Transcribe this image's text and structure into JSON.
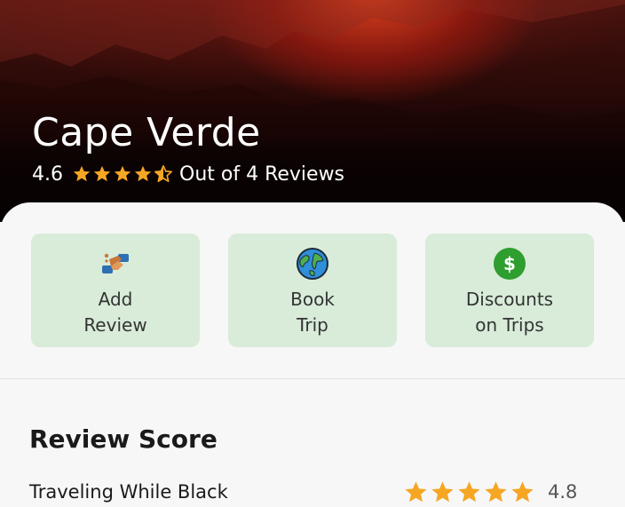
{
  "destination": {
    "name": "Cape Verde",
    "rating": "4.6",
    "rating_stars": 4.5,
    "reviews_text": "Out of 4 Reviews"
  },
  "actions": [
    {
      "line1": "Add",
      "line2": "Review",
      "icon": "handshake-icon"
    },
    {
      "line1": "Book",
      "line2": "Trip",
      "icon": "globe-icon"
    },
    {
      "line1": "Discounts",
      "line2": "on Trips",
      "icon": "dollar-coin-icon"
    }
  ],
  "review_score": {
    "title": "Review Score",
    "rows": [
      {
        "label": "Traveling While Black",
        "value": "4.8",
        "stars": 5
      }
    ]
  },
  "colors": {
    "star": "#f5a623",
    "card": "#d8ecd9",
    "coin": "#2e9e2e"
  }
}
